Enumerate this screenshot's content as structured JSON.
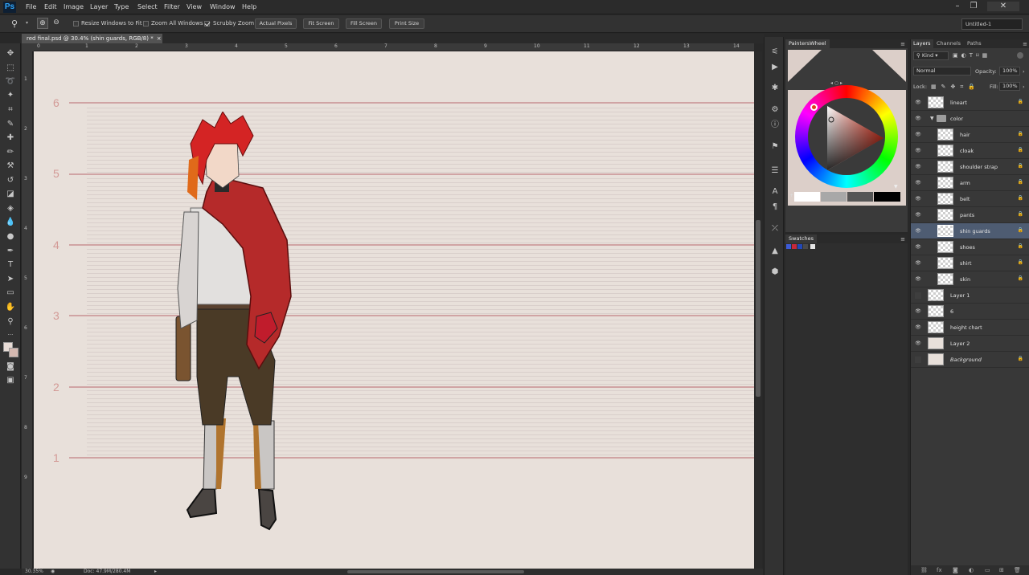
{
  "app": {
    "logo": "Ps"
  },
  "menu": [
    "File",
    "Edit",
    "Image",
    "Layer",
    "Type",
    "Select",
    "Filter",
    "View",
    "Window",
    "Help"
  ],
  "options": {
    "resize_windows": "Resize Windows to Fit",
    "zoom_all": "Zoom All Windows",
    "scrubby_zoom": "Scrubby Zoom",
    "actual_pixels": "Actual Pixels",
    "fit_screen": "Fit Screen",
    "fill_screen": "Fill Screen",
    "print_size": "Print Size",
    "workspace": "Untitled-1"
  },
  "document": {
    "tab_title": "red final.psd @ 30.4% (shin guards, RGB/8) *",
    "zoom_status": "30.35%",
    "doc_status": "Doc: 47.9M/280.4M"
  },
  "rulers": {
    "top": [
      "0",
      "1",
      "2",
      "3",
      "4",
      "5",
      "6",
      "7",
      "8",
      "9",
      "10",
      "11",
      "12",
      "13",
      "14"
    ],
    "left": [
      "1",
      "2",
      "3",
      "4",
      "5",
      "6",
      "7",
      "8",
      "9"
    ]
  },
  "canvas": {
    "height_labels": [
      "6",
      "5",
      "4",
      "3",
      "2",
      "1"
    ],
    "background_color": "#e8e0da",
    "line_color": "#d0a4a4"
  },
  "painters_wheel": {
    "tab": "PaintersWheel",
    "shades": [
      "#ffffff",
      "#a8a8a8",
      "#555555",
      "#000000"
    ]
  },
  "swatches": {
    "tab": "Swatches",
    "colors": [
      "#3d5bd6",
      "#c8283a",
      "#2248b8",
      "#4a4a4a",
      "#e6e6e6"
    ]
  },
  "layers": {
    "tabs": [
      "Layers",
      "Channels",
      "Paths"
    ],
    "kind_label": "Kind",
    "blend_mode": "Normal",
    "opacity_label": "Opacity:",
    "opacity_value": "100%",
    "lock_label": "Lock:",
    "fill_label": "Fill:",
    "fill_value": "100%",
    "items": [
      {
        "name": "lineart",
        "indent": 0,
        "visible": true,
        "selected": false
      },
      {
        "name": "color",
        "indent": 0,
        "visible": true,
        "selected": false,
        "group": true
      },
      {
        "name": "hair",
        "indent": 1,
        "visible": true,
        "selected": false
      },
      {
        "name": "cloak",
        "indent": 1,
        "visible": true,
        "selected": false
      },
      {
        "name": "shoulder strap",
        "indent": 1,
        "visible": true,
        "selected": false
      },
      {
        "name": "arm",
        "indent": 1,
        "visible": true,
        "selected": false
      },
      {
        "name": "belt",
        "indent": 1,
        "visible": true,
        "selected": false
      },
      {
        "name": "pants",
        "indent": 1,
        "visible": true,
        "selected": false
      },
      {
        "name": "shin guards",
        "indent": 1,
        "visible": true,
        "selected": true
      },
      {
        "name": "shoes",
        "indent": 1,
        "visible": true,
        "selected": false
      },
      {
        "name": "shirt",
        "indent": 1,
        "visible": true,
        "selected": false
      },
      {
        "name": "skin",
        "indent": 1,
        "visible": true,
        "selected": false
      },
      {
        "name": "Layer 1",
        "indent": 0,
        "visible": false,
        "selected": false
      },
      {
        "name": "6",
        "indent": 0,
        "visible": true,
        "selected": false
      },
      {
        "name": "height chart",
        "indent": 0,
        "visible": true,
        "selected": false
      },
      {
        "name": "Layer 2",
        "indent": 0,
        "visible": true,
        "selected": false
      },
      {
        "name": "Background",
        "indent": 0,
        "visible": false,
        "selected": false,
        "italic": true
      }
    ]
  }
}
